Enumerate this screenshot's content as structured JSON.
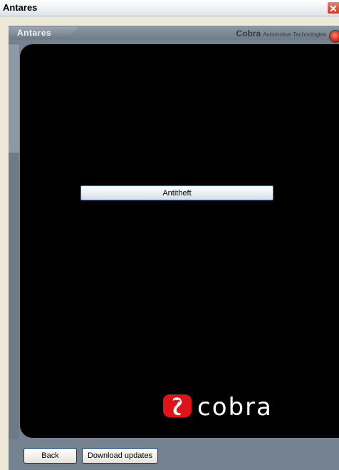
{
  "window": {
    "title": "Antares",
    "close_glyph": "✕"
  },
  "header": {
    "tab_label": "Antares",
    "brand_name": "Cobra",
    "brand_tagline": "Automotive Technologies",
    "status_led": "red-status-led"
  },
  "main": {
    "button_label": "Antitheft"
  },
  "logo": {
    "wordmark": "cobra",
    "mark_color": "#e0131b"
  },
  "footer": {
    "back_label": "Back",
    "download_label": "Download updates"
  },
  "colors": {
    "frame": "#758391",
    "screen": "#000000",
    "accent_red": "#d6321c"
  }
}
